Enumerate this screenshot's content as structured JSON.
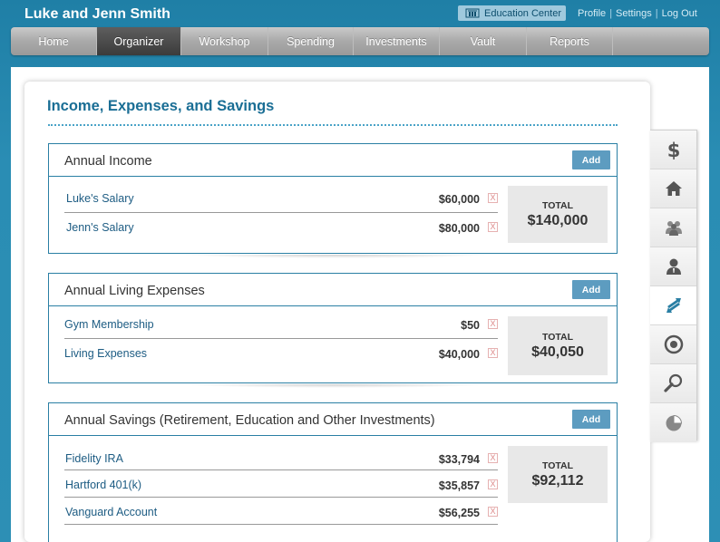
{
  "header": {
    "family_name": "Luke and Jenn Smith",
    "education_center": "Education Center",
    "links": [
      "Profile",
      "Settings",
      "Log Out"
    ]
  },
  "nav": {
    "items": [
      {
        "label": "Home",
        "active": false
      },
      {
        "label": "Organizer",
        "active": true
      },
      {
        "label": "Workshop",
        "active": false
      },
      {
        "label": "Spending",
        "active": false
      },
      {
        "label": "Investments",
        "active": false
      },
      {
        "label": "Vault",
        "active": false
      },
      {
        "label": "Reports",
        "active": false
      }
    ]
  },
  "page": {
    "title": "Income, Expenses, and Savings",
    "add_label": "Add",
    "total_label": "TOTAL",
    "delete_symbol": "X",
    "sections": [
      {
        "title": "Annual Income",
        "rows": [
          {
            "name": "Luke's Salary",
            "amount": "$60,000"
          },
          {
            "name": "Jenn's Salary",
            "amount": "$80,000"
          }
        ],
        "total": "$140,000"
      },
      {
        "title": "Annual Living Expenses",
        "rows": [
          {
            "name": "Gym Membership",
            "amount": "$50"
          },
          {
            "name": "Living Expenses",
            "amount": "$40,000"
          }
        ],
        "total": "$40,050"
      },
      {
        "title": "Annual Savings (Retirement, Education and Other Investments)",
        "rows": [
          {
            "name": "Fidelity IRA",
            "amount": "$33,794"
          },
          {
            "name": "Hartford 401(k)",
            "amount": "$35,857"
          },
          {
            "name": "Vanguard Account",
            "amount": "$56,255"
          }
        ],
        "total": "$92,112"
      }
    ]
  },
  "sidebar": {
    "items": [
      {
        "icon": "dollar-icon"
      },
      {
        "icon": "house-icon"
      },
      {
        "icon": "people-icon"
      },
      {
        "icon": "person-icon"
      },
      {
        "icon": "transfer-arrows-icon",
        "active": true
      },
      {
        "icon": "target-icon"
      },
      {
        "icon": "magnifier-icon"
      },
      {
        "icon": "pie-chart-icon"
      }
    ]
  },
  "colors": {
    "brand_blue": "#1a6e95",
    "header_bg": "#2a8db4",
    "add_button": "#5d9cc0"
  }
}
